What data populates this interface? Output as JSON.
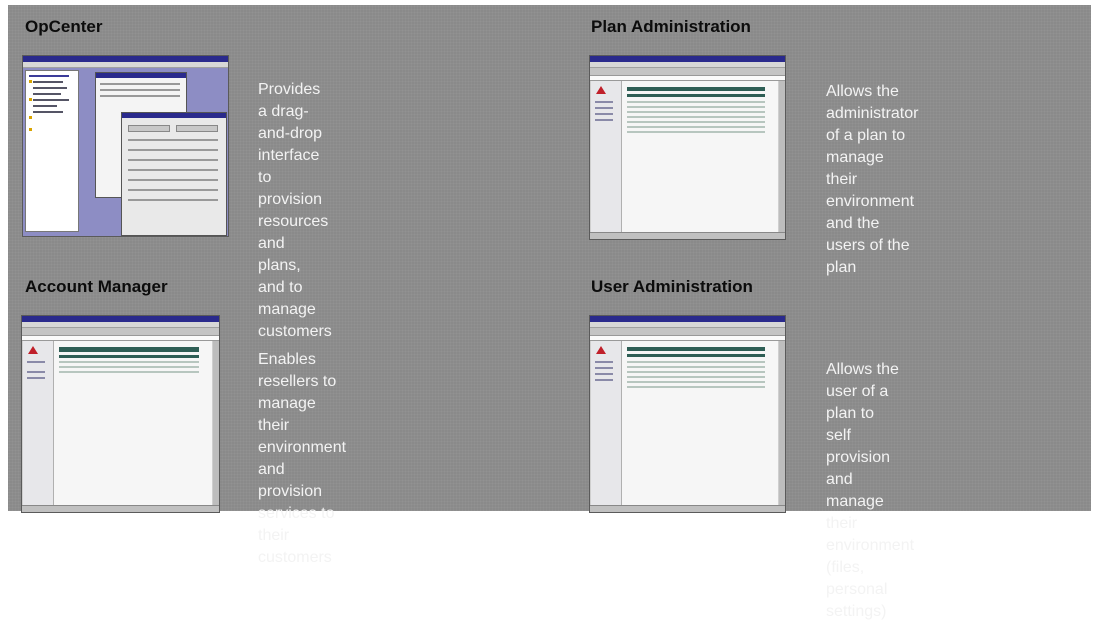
{
  "panels": [
    {
      "title": "OpCenter",
      "description": "Provides a drag-and-drop\ninterface to provision\nresources and plans, and to\nmanage customers",
      "thumbnail_icon": "opcenter-window-screenshot"
    },
    {
      "title": "Plan Administration",
      "description": "Allows the administrator\nof a plan to manage their\nenvironment and the\nusers of the plan",
      "thumbnail_icon": "plan-admin-browser-screenshot"
    },
    {
      "title": "Account Manager",
      "description": "Enables resellers to\nmanage  their environment\nand provision services to\ntheir customers",
      "thumbnail_icon": "account-manager-browser-screenshot"
    },
    {
      "title": "User Administration",
      "description": "Allows the user of a plan to\nself provision and manage\ntheir environment (files,\npersonal settings)",
      "thumbnail_icon": "user-admin-browser-screenshot"
    }
  ],
  "colors": {
    "background": "#8a8a8a",
    "title_text": "#0c0c0c",
    "description_text": "#f3f3f3",
    "window_titlebar": "#2a2a8c",
    "table_header": "#2e5e55",
    "opcenter_desktop": "#8d8dc4"
  }
}
